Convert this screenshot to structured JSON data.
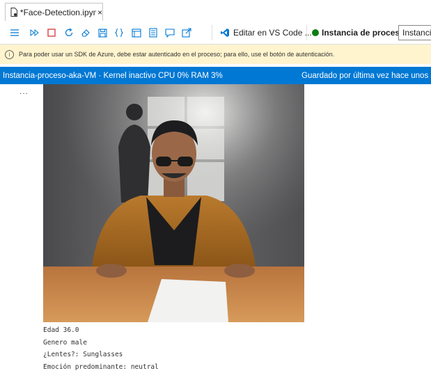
{
  "tab": {
    "title": "*Face-Detection.ipynb",
    "close_glyph": "×"
  },
  "toolbar": {
    "icons": [
      "menu-icon",
      "run-all-icon",
      "stop-icon",
      "restart-icon",
      "clear-outputs-icon",
      "save-icon",
      "variables-icon",
      "table-of-contents-icon",
      "outline-icon",
      "comments-icon",
      "export-icon"
    ],
    "vscode_label": "Editar en VS Code ...",
    "compute_label": "Instancia de proceso:",
    "compute_value": "Instancia",
    "compute_status_color": "#107c10"
  },
  "warning": {
    "text": "Para poder usar un SDK de Azure, debe estar autenticado en el proceso; para ello, use el botón de autenticación."
  },
  "statusbar": {
    "left": "Instancia-proceso-aka-VM · Kernel inactivo  CPU  0%  RAM  3%",
    "right": "Guardado por última vez hace unos segundos"
  },
  "cell": {
    "collapse_glyph": "...",
    "output_lines": [
      "Edad 36.0",
      "Genero male",
      "¿Lentes?: Sunglasses",
      "Emoción predominante: neutral"
    ]
  },
  "colors": {
    "accent": "#0078d4",
    "warning_bg": "#fff4ce",
    "running_green": "#107c10"
  }
}
